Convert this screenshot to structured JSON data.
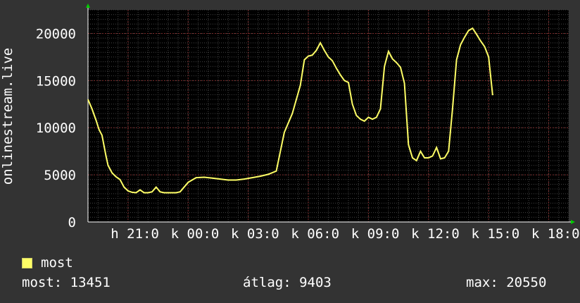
{
  "chart_data": {
    "type": "line",
    "ylabel": "onlinestream.live",
    "xtick_labels": [
      "h 21:0",
      "k 00:0",
      "k 03:0",
      "k 06:0",
      "k 09:0",
      "k 12:0",
      "k 15:0",
      "k 18:0"
    ],
    "xticks_hours": [
      2,
      5,
      8,
      11,
      14,
      17,
      20,
      23
    ],
    "yticks": [
      0,
      5000,
      10000,
      15000,
      20000
    ],
    "ylim": [
      0,
      22500
    ],
    "xlim_hours": [
      0,
      24
    ],
    "grid": true,
    "series": [
      {
        "name": "most",
        "color": "#ffff66",
        "x_hours": [
          0.0,
          0.2,
          0.4,
          0.55,
          0.7,
          0.9,
          1.0,
          1.2,
          1.4,
          1.6,
          1.8,
          2.0,
          2.2,
          2.4,
          2.6,
          2.8,
          3.0,
          3.2,
          3.4,
          3.6,
          3.8,
          4.0,
          4.2,
          4.4,
          4.6,
          5.0,
          5.4,
          5.8,
          6.2,
          6.6,
          7.0,
          7.4,
          7.8,
          8.2,
          8.6,
          9.0,
          9.4,
          9.8,
          10.2,
          10.4,
          10.6,
          10.8,
          11.0,
          11.2,
          11.4,
          11.6,
          11.8,
          12.0,
          12.2,
          12.4,
          12.6,
          12.8,
          13.0,
          13.2,
          13.4,
          13.6,
          13.8,
          14.0,
          14.2,
          14.4,
          14.6,
          14.8,
          15.0,
          15.2,
          15.4,
          15.6,
          15.8,
          16.0,
          16.2,
          16.4,
          16.6,
          16.8,
          17.0,
          17.2,
          17.4,
          17.6,
          17.8,
          18.0,
          18.2,
          18.4,
          18.6,
          18.8,
          19.0,
          19.2,
          19.4,
          19.6,
          19.8,
          20.0,
          20.2,
          20.4,
          20.6,
          20.8,
          21.0,
          21.2,
          21.4,
          21.6,
          21.8,
          22.0,
          22.2,
          22.4,
          22.6,
          22.8,
          23.0,
          23.2,
          23.4,
          23.6,
          23.8,
          24.0
        ],
        "values": [
          13000,
          12000,
          10800,
          9800,
          9200,
          7000,
          6000,
          5200,
          4800,
          4500,
          3700,
          3300,
          3150,
          3100,
          3400,
          3100,
          3100,
          3200,
          3700,
          3200,
          3100,
          3100,
          3100,
          3100,
          3200,
          4200,
          4700,
          4750,
          4650,
          4550,
          4450,
          4450,
          4550,
          4700,
          4850,
          5050,
          5400,
          9500,
          11500,
          13000,
          14500,
          17200,
          17600,
          17700,
          18200,
          19000,
          18200,
          17500,
          17100,
          16300,
          15600,
          15000,
          14800,
          12500,
          11300,
          10900,
          10700,
          11100,
          10900,
          11100,
          12000,
          16500,
          18100,
          17300,
          16900,
          16400,
          14700,
          8200,
          6800,
          6500,
          7500,
          6800,
          6800,
          7000,
          7900,
          6700,
          6800,
          7500,
          12000,
          17200,
          18800,
          19600,
          20300,
          20550,
          19900,
          19200,
          18600,
          17500,
          13451
        ]
      }
    ]
  },
  "legend": {
    "label": "most"
  },
  "stats": {
    "now_label": "most:",
    "now_value": "13451",
    "avg_label": "átlag:",
    "avg_value": "9403",
    "max_label": "max:",
    "max_value": "20550"
  }
}
